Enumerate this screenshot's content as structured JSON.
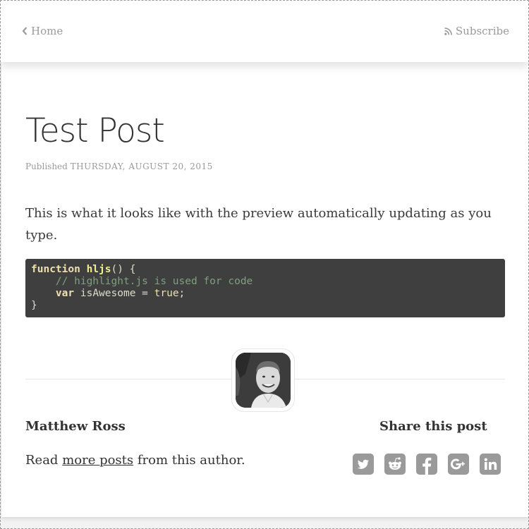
{
  "nav": {
    "home_label": "Home",
    "subscribe_label": "Subscribe"
  },
  "post": {
    "title": "Test Post",
    "published_label": "Published",
    "date": "THURSDAY, AUGUST 20, 2015",
    "body": "This is what it looks like with the preview automatically updating as you type.",
    "code": {
      "language": "javascript",
      "lines": [
        "function hljs() {",
        "    // highlight.js is used for code",
        "    var isAwesome = true;",
        "}"
      ]
    }
  },
  "author": {
    "name": "Matthew Ross",
    "read_prefix": "Read ",
    "read_link": "more posts",
    "read_suffix": " from this author."
  },
  "share": {
    "title": "Share this post",
    "icons": [
      "twitter-icon",
      "reddit-icon",
      "facebook-icon",
      "google-plus-icon",
      "linkedin-icon"
    ]
  },
  "colors": {
    "icon_gray": "#9a9a9a",
    "code_bg": "#3f3f3f"
  }
}
